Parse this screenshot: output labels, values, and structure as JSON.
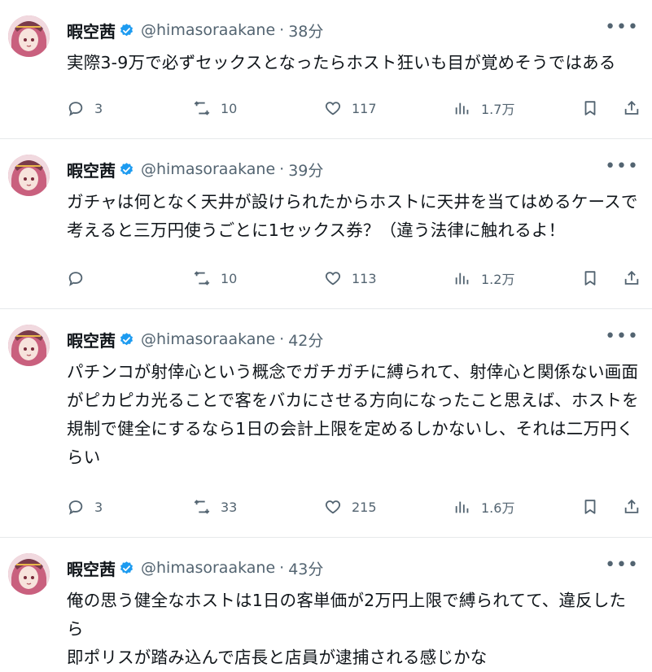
{
  "tweets": [
    {
      "name": "暇空茜",
      "handle": "@himasoraakane",
      "sep": "·",
      "time": "38分",
      "text": "実際3-9万で必ずセックスとなったらホスト狂いも目が覚めそうではある",
      "replies": "3",
      "retweets": "10",
      "likes": "117",
      "views": "1.7万"
    },
    {
      "name": "暇空茜",
      "handle": "@himasoraakane",
      "sep": "·",
      "time": "39分",
      "text": "ガチャは何となく天井が設けられたからホストに天井を当てはめるケースで\n考えると三万円使うごとに1セックス券？（違う法律に触れるよ！",
      "replies": "",
      "retweets": "10",
      "likes": "113",
      "views": "1.2万"
    },
    {
      "name": "暇空茜",
      "handle": "@himasoraakane",
      "sep": "·",
      "time": "42分",
      "text": "パチンコが射倖心という概念でガチガチに縛られて、射倖心と関係ない画面\nがピカピカ光ることで客をバカにさせる方向になったこと思えば、ホストを\n規制で健全にするなら1日の会計上限を定めるしかないし、それは二万円く\nらい",
      "replies": "3",
      "retweets": "33",
      "likes": "215",
      "views": "1.6万"
    },
    {
      "name": "暇空茜",
      "handle": "@himasoraakane",
      "sep": "·",
      "time": "43分",
      "text": "俺の思う健全なホストは1日の客単価が2万円上限で縛られてて、違反したら\n即ポリスが踏み込んで店長と店員が逮捕される感じかな",
      "replies": "",
      "retweets": "",
      "likes": "",
      "views": ""
    }
  ],
  "colors": {
    "text": "#0f1419",
    "muted": "#536471",
    "verified": "#1d9bf0",
    "divider": "#e6e9eb"
  },
  "icons": [
    "avatar",
    "verified-badge-icon",
    "more-icon",
    "reply-icon",
    "retweet-icon",
    "like-icon",
    "views-icon",
    "bookmark-icon",
    "share-icon"
  ]
}
